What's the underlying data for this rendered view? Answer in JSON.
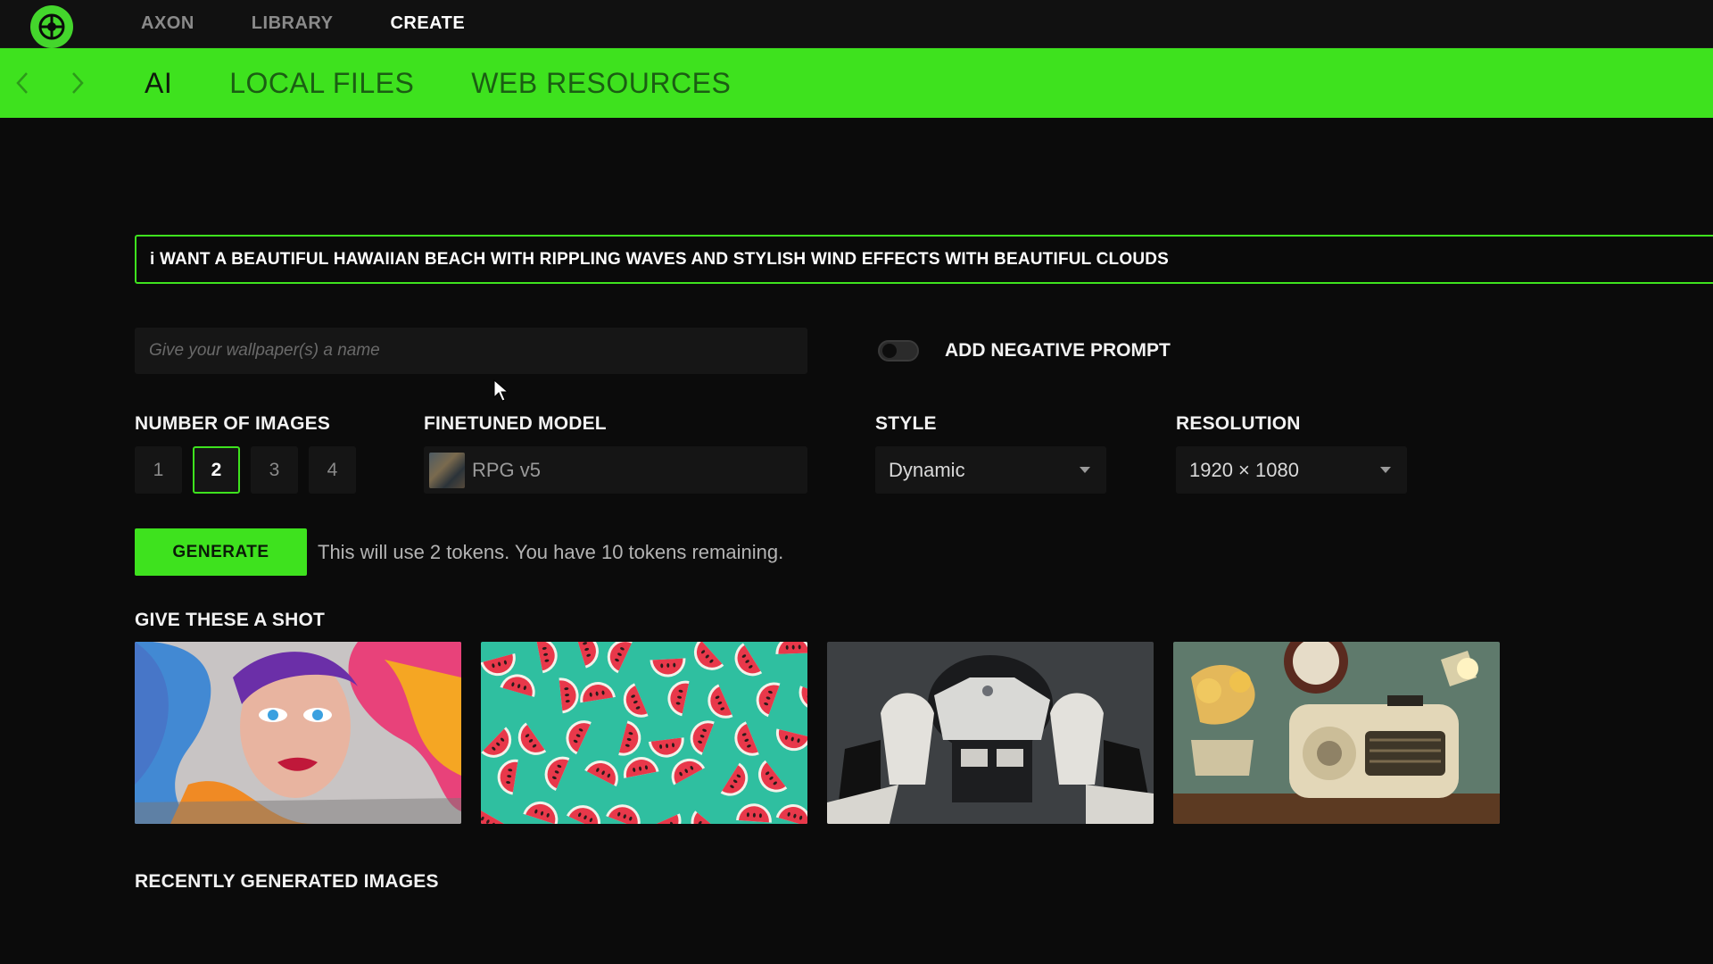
{
  "topnav": {
    "items": [
      {
        "label": "AXON",
        "active": false
      },
      {
        "label": "LIBRARY",
        "active": false
      },
      {
        "label": "CREATE",
        "active": true
      }
    ]
  },
  "subnav": {
    "tabs": [
      {
        "label": "AI",
        "active": true
      },
      {
        "label": "LOCAL FILES",
        "active": false
      },
      {
        "label": "WEB RESOURCES",
        "active": false
      }
    ]
  },
  "prompt": {
    "value": "i WANT A BEAUTIFUL HAWAIIAN BEACH WITH RIPPLING WAVES AND STYLISH WIND EFFECTS WITH BEAUTIFUL CLOUDS"
  },
  "name_input": {
    "placeholder": "Give your wallpaper(s) a name",
    "value": ""
  },
  "negative_prompt": {
    "label": "ADD NEGATIVE PROMPT",
    "enabled": false
  },
  "number_of_images": {
    "label": "NUMBER OF IMAGES",
    "options": [
      "1",
      "2",
      "3",
      "4"
    ],
    "selected": "2"
  },
  "finetuned_model": {
    "label": "FINETUNED MODEL",
    "value": "RPG v5"
  },
  "style": {
    "label": "STYLE",
    "value": "Dynamic"
  },
  "resolution": {
    "label": "RESOLUTION",
    "value": "1920 × 1080"
  },
  "generate": {
    "label": "GENERATE",
    "info": "This will use 2 tokens. You have 10 tokens remaining."
  },
  "suggestions": {
    "title": "GIVE THESE A SHOT",
    "images": [
      "graffiti-woman-image",
      "watermelon-pattern-image",
      "robot-mech-image",
      "vintage-radio-image"
    ]
  },
  "recent": {
    "title": "RECENTLY GENERATED IMAGES"
  },
  "colors": {
    "accent": "#3ee21e",
    "background": "#0b0b0b",
    "topbar": "#111111"
  }
}
